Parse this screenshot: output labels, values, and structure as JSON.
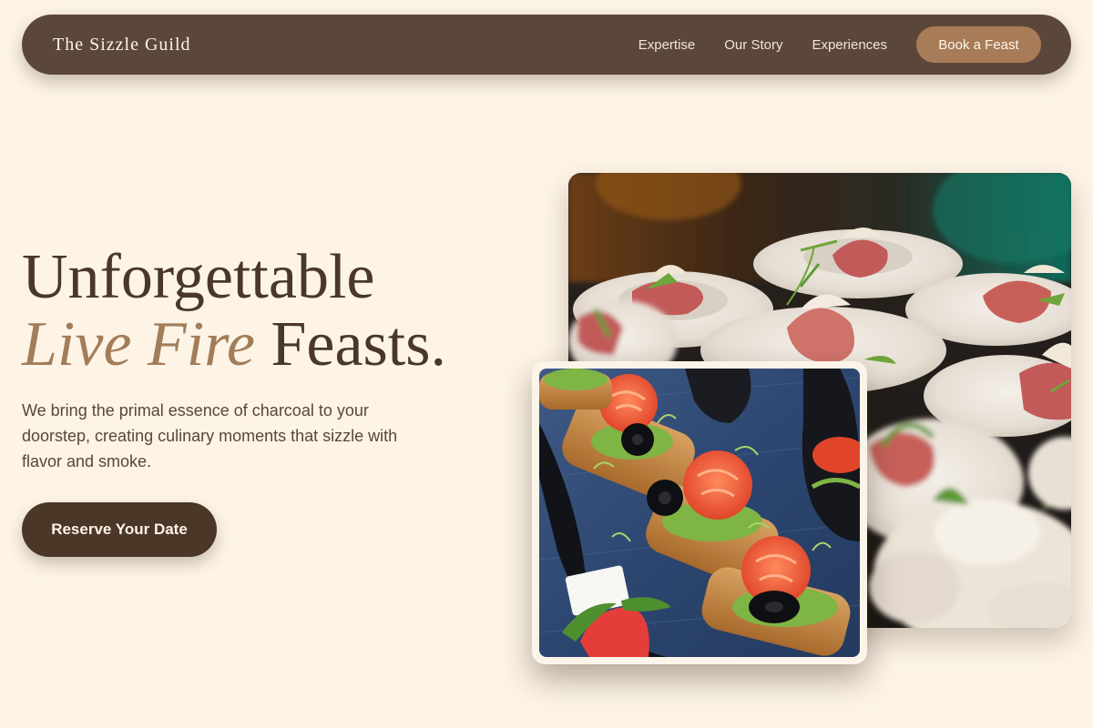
{
  "nav": {
    "brand": "The Sizzle Guild",
    "links": [
      {
        "label": "Expertise"
      },
      {
        "label": "Our Story"
      },
      {
        "label": "Experiences"
      }
    ],
    "cta_label": "Book a Feast"
  },
  "hero": {
    "title_line1": "Unforgettable",
    "title_accent": "Live Fire",
    "title_rest": " Feasts.",
    "description": "We bring the primal essence of charcoal to your doorstep, creating culinary moments that sizzle with flavor and smoke.",
    "cta_label": "Reserve Your Date"
  },
  "images": {
    "main": "plated-prosciutto-appetizers-photo",
    "inset": "smoked-salmon-crostini-photo"
  },
  "colors": {
    "background": "#fdf4e6",
    "nav_bg": "#5b4739",
    "accent": "#a87c59",
    "dark_brown": "#4a3728"
  }
}
